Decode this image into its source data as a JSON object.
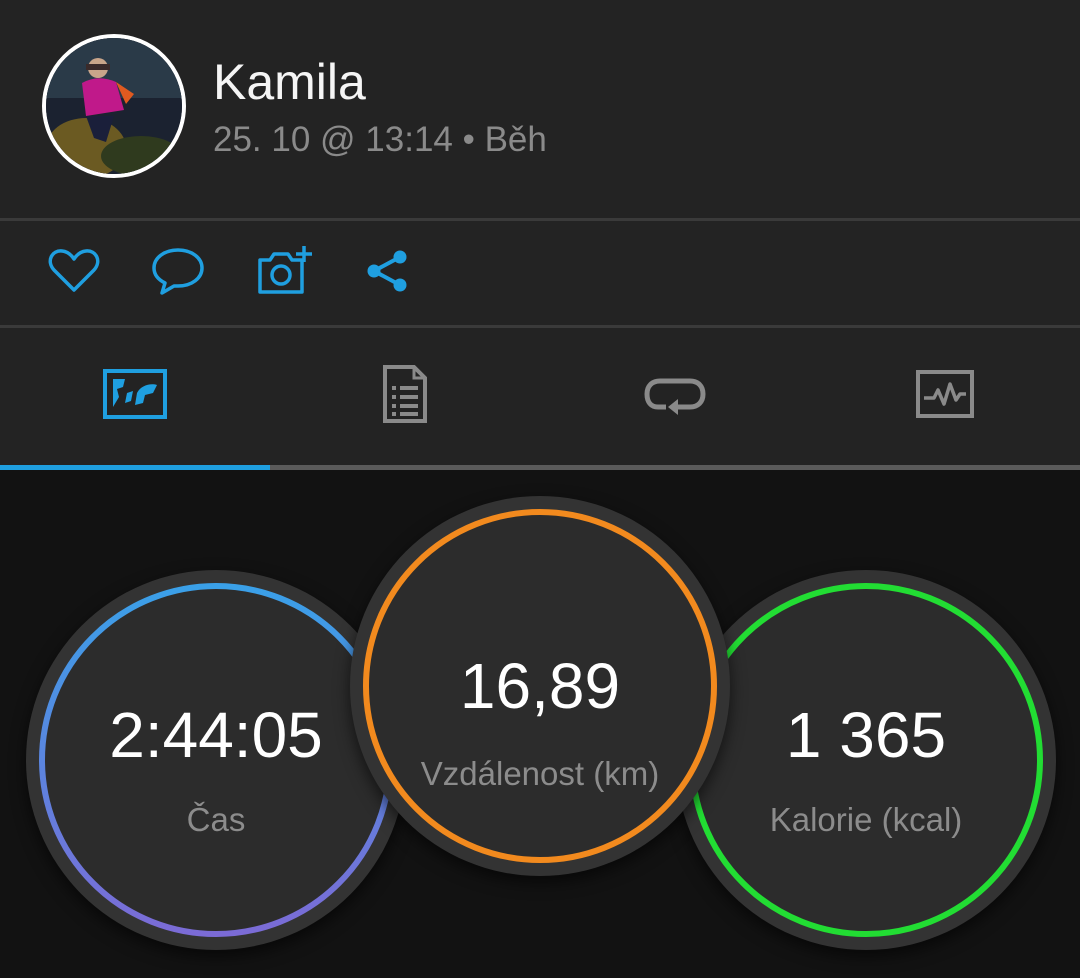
{
  "user": {
    "name": "Kamila",
    "activity_meta": "25. 10 @ 13:14 • Běh"
  },
  "actions": [
    {
      "icon": "heart-icon",
      "label": "like"
    },
    {
      "icon": "comment-icon",
      "label": "comment"
    },
    {
      "icon": "add-photo-icon",
      "label": "add photo"
    },
    {
      "icon": "share-icon",
      "label": "share"
    }
  ],
  "tabs": [
    {
      "icon": "map-icon",
      "active": true
    },
    {
      "icon": "document-list-icon",
      "active": false
    },
    {
      "icon": "repeat-icon",
      "active": false
    },
    {
      "icon": "chart-icon",
      "active": false
    }
  ],
  "stats": {
    "time": {
      "value": "2:44:05",
      "label": "Čas"
    },
    "distance": {
      "value": "16,89",
      "label": "Vzdálenost (km)"
    },
    "calories": {
      "value": "1 365",
      "label": "Kalorie (kcal)"
    }
  },
  "colors": {
    "accent": "#1f9fe0",
    "time_ring_start": "#3aa0e8",
    "time_ring_end": "#7b6bd6",
    "distance_ring": "#f28a1e",
    "calories_ring": "#22dd33"
  }
}
